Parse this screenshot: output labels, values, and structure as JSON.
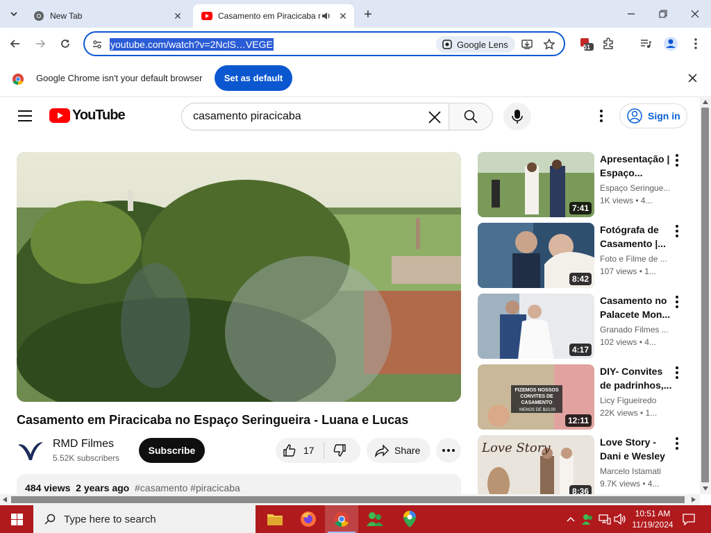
{
  "browser": {
    "tabs": [
      {
        "title": "New Tab",
        "active": false
      },
      {
        "title": "Casamento em Piracicaba n",
        "active": true
      }
    ],
    "url": "youtube.com/watch?v=2NclS…VEGE",
    "lens_label": "Google Lens",
    "extensions_badge": "51"
  },
  "infobar": {
    "message": "Google Chrome isn't your default browser",
    "button": "Set as default"
  },
  "youtube": {
    "logo_text": "YouTube",
    "search_query": "casamento piracicaba",
    "sign_in": "Sign in",
    "video": {
      "title": "Casamento em Piracicaba no Espaço Seringueira - Luana e Lucas",
      "channel": "RMD Filmes",
      "subscribers": "5.52K subscribers",
      "subscribe": "Subscribe",
      "likes": "17",
      "share": "Share",
      "views": "484 views",
      "age": "2 years ago",
      "tags": "#casamento #piracicaba"
    },
    "related": [
      {
        "title": "Apresentação | Espaço...",
        "channel": "Espaço Seringue...",
        "meta": "1K views • 4...",
        "duration": "7:41"
      },
      {
        "title": "Fotógrafa de Casamento |...",
        "channel": "Foto e Filme de ...",
        "meta": "107 views • 1...",
        "duration": "8:42"
      },
      {
        "title": "Casamento no Palacete Mon...",
        "channel": "Granado Filmes ...",
        "meta": "102 views • 4...",
        "duration": "4:17"
      },
      {
        "title": "DIY- Convites de padrinhos,...",
        "channel": "Licy Figueiredo",
        "meta": "22K views • 1...",
        "duration": "12:11",
        "overlay": "FIZEMOS NOSSOS CONVITES DE CASAMENTO",
        "overlay2": "MENOS DE $10,00"
      },
      {
        "title": "Love Story - Dani e Wesley",
        "channel": "Marcelo Istamati",
        "meta": "9.7K views • 4...",
        "duration": "8:36",
        "overlay": "Love Story"
      }
    ]
  },
  "taskbar": {
    "search_placeholder": "Type here to search",
    "time": "10:51 AM",
    "date": "11/19/2024"
  }
}
